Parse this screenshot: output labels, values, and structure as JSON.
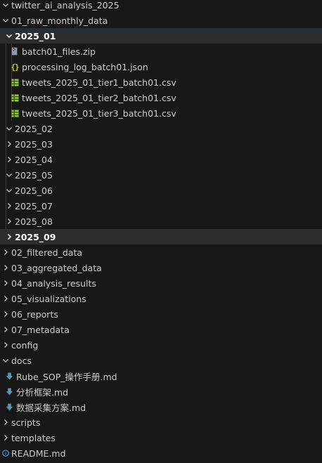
{
  "explorer": {
    "root": {
      "label": "twitter_ai_analysis_2025"
    },
    "raw": {
      "label": "01_raw_monthly_data"
    },
    "month_2025_01": {
      "label": "2025_01",
      "files": [
        {
          "label": "batch01_files.zip",
          "icon": "zip-file-icon"
        },
        {
          "label": "processing_log_batch01.json",
          "icon": "json-file-icon"
        },
        {
          "label": "tweets_2025_01_tier1_batch01.csv",
          "icon": "csv-file-icon"
        },
        {
          "label": "tweets_2025_01_tier2_batch01.csv",
          "icon": "csv-file-icon"
        },
        {
          "label": "tweets_2025_01_tier3_batch01.csv",
          "icon": "csv-file-icon"
        }
      ]
    },
    "months": [
      {
        "label": "2025_02",
        "state": "expanded"
      },
      {
        "label": "2025_03",
        "state": "collapsed"
      },
      {
        "label": "2025_04",
        "state": "collapsed"
      },
      {
        "label": "2025_05",
        "state": "expanded"
      },
      {
        "label": "2025_06",
        "state": "expanded"
      },
      {
        "label": "2025_07",
        "state": "collapsed"
      },
      {
        "label": "2025_08",
        "state": "collapsed"
      },
      {
        "label": "2025_09",
        "state": "collapsed",
        "selected": true
      }
    ],
    "folders": [
      {
        "label": "02_filtered_data"
      },
      {
        "label": "03_aggregated_data"
      },
      {
        "label": "04_analysis_results"
      },
      {
        "label": "05_visualizations"
      },
      {
        "label": "06_reports"
      },
      {
        "label": "07_metadata"
      },
      {
        "label": "config"
      }
    ],
    "docs": {
      "label": "docs",
      "files": [
        {
          "label": "Rube_SOP_操作手册.md",
          "icon": "markdown-file-icon"
        },
        {
          "label": "分析框架.md",
          "icon": "markdown-file-icon"
        },
        {
          "label": "数据采集方案.md",
          "icon": "markdown-file-icon"
        }
      ]
    },
    "tail_folders": [
      {
        "label": "scripts"
      },
      {
        "label": "templates"
      }
    ],
    "readme": {
      "label": "README.md",
      "icon": "info-icon"
    }
  },
  "colors": {
    "background": "#181818",
    "selected_row": "#2b2d2e",
    "text": "#cccccc",
    "csv_icon": "#8dc149",
    "json_icon": "#cbcb41",
    "markdown_icon": "#519aba",
    "info_icon": "#58a6ff"
  }
}
